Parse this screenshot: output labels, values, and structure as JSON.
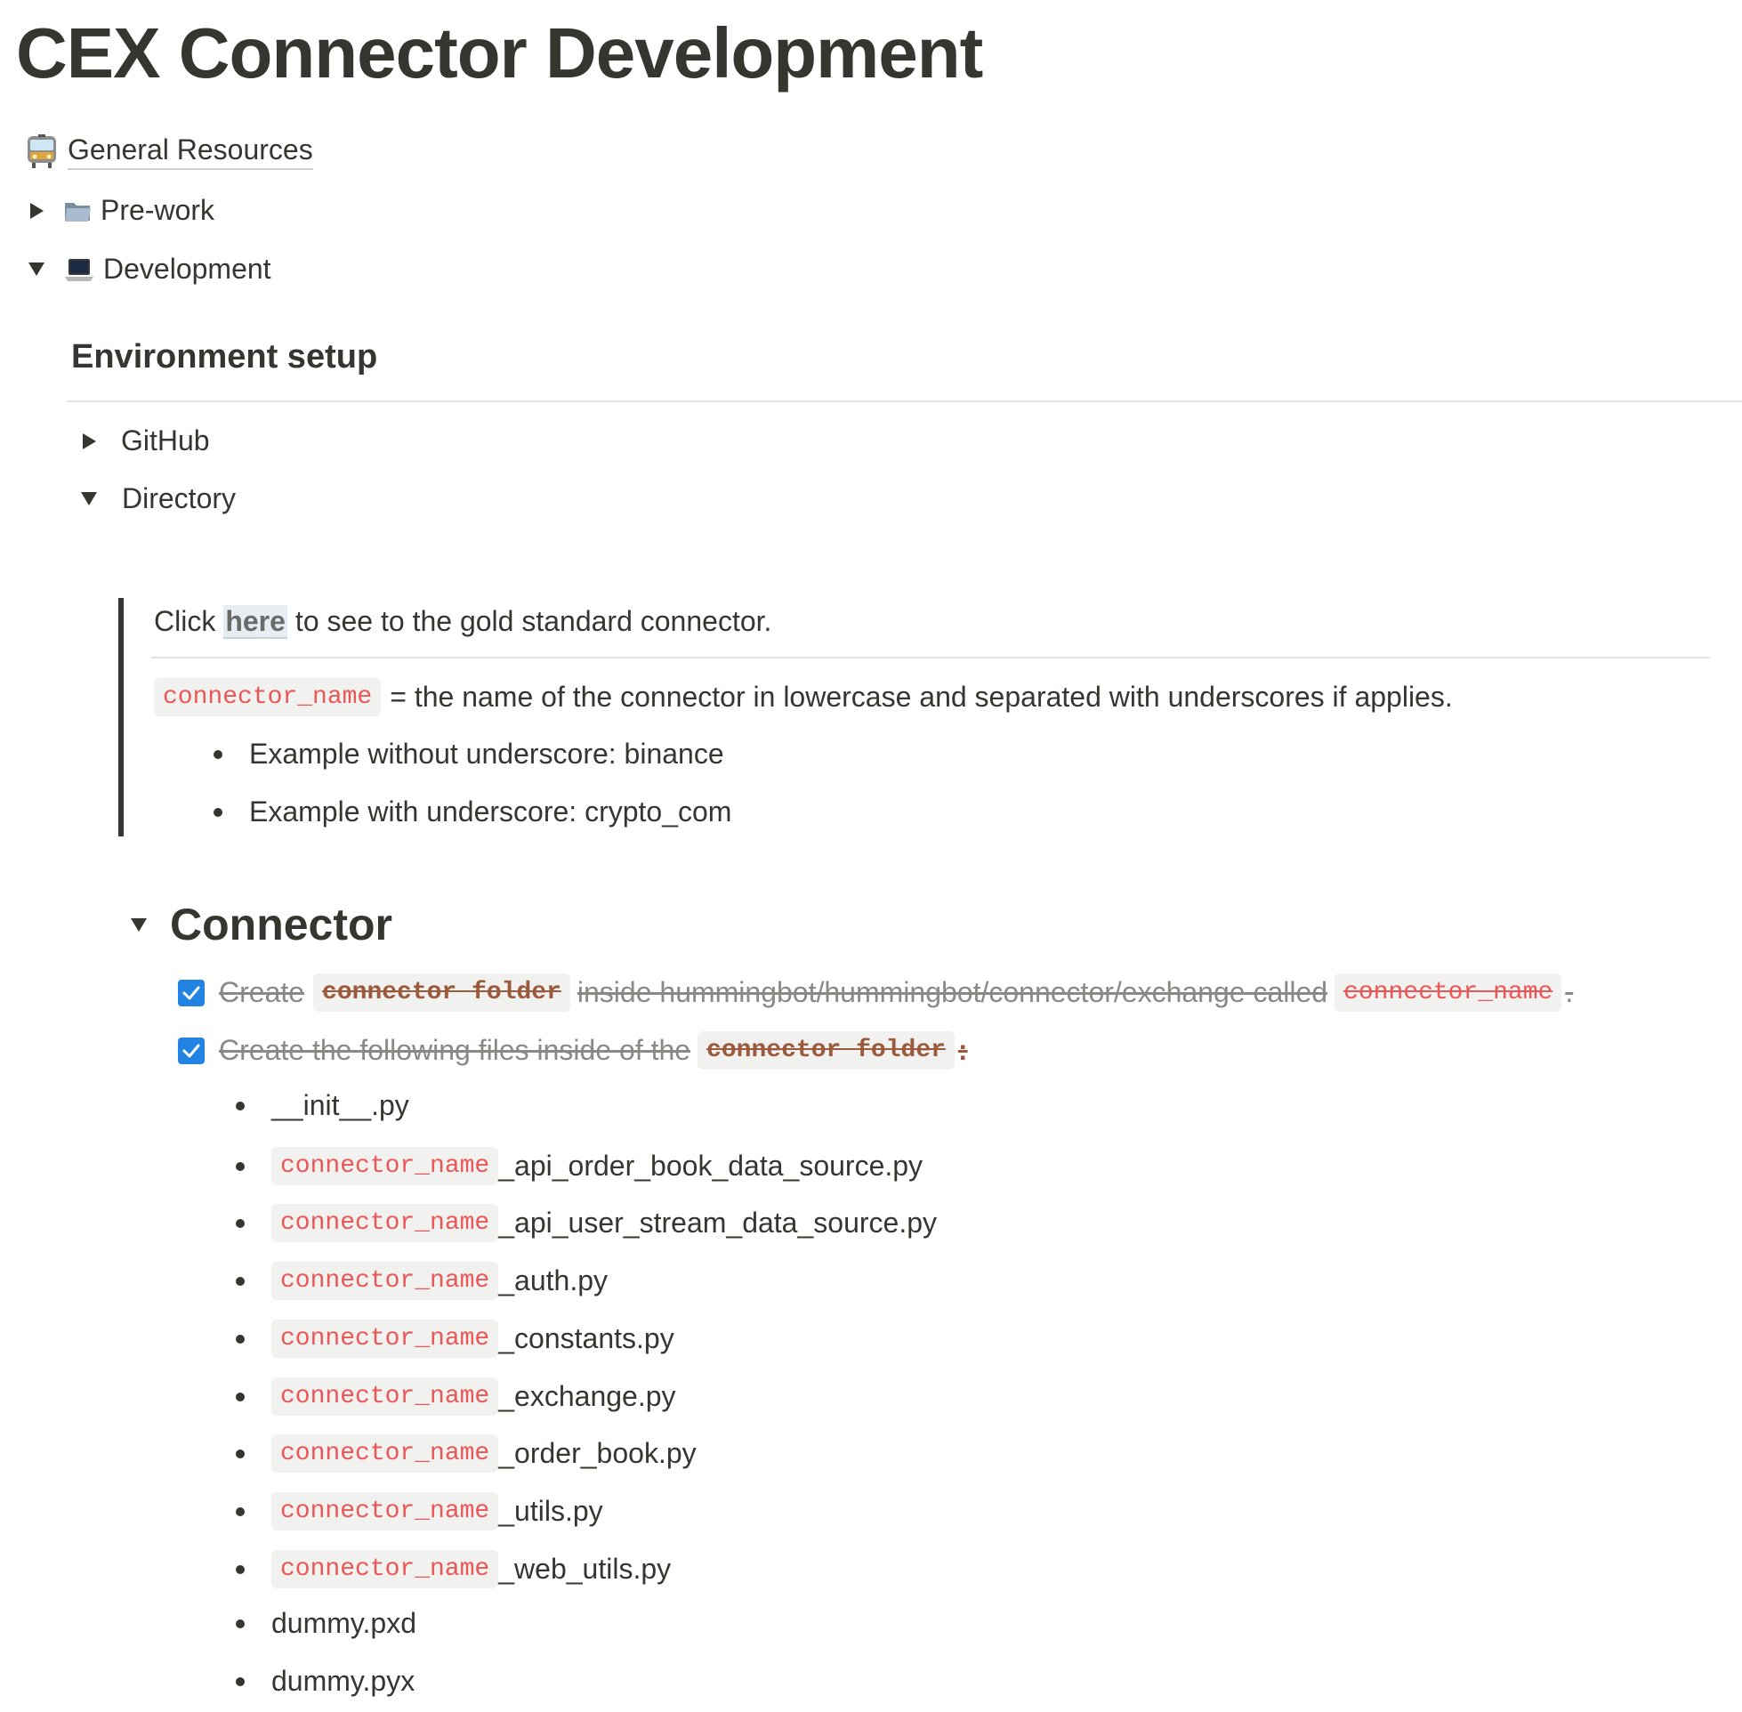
{
  "page": {
    "title": "CEX Connector Development"
  },
  "links": {
    "general_resources": "General Resources"
  },
  "toggles": {
    "prework": "Pre-work",
    "development": "Development"
  },
  "section_env": {
    "heading": "Environment setup",
    "github": "GitHub",
    "directory": "Directory"
  },
  "callout": {
    "line1_prefix": "Click",
    "line1_link": "here",
    "line1_suffix": "to see to the gold standard connector.",
    "code_term": "connector_name",
    "definition": "= the name of the connector in lowercase and separated with underscores if applies.",
    "examples": [
      "Example without underscore: binance",
      "Example with underscore: crypto_com"
    ]
  },
  "connector": {
    "heading": "Connector",
    "task1": {
      "checked": true,
      "prefix": "Create",
      "code1": "connector folder",
      "middle": "inside hummingbot/hummingbot/connector/exchange called",
      "code2": "connector_name",
      "suffix": "."
    },
    "task2": {
      "checked": true,
      "prefix": "Create the following files inside of the",
      "code": "connector folder",
      "suffix": ":"
    },
    "files": [
      {
        "code": "",
        "name": "__init__.py"
      },
      {
        "code": "connector_name",
        "name": "_api_order_book_data_source.py"
      },
      {
        "code": "connector_name",
        "name": "_api_user_stream_data_source.py"
      },
      {
        "code": "connector_name",
        "name": "_auth.py"
      },
      {
        "code": "connector_name",
        "name": "_constants.py"
      },
      {
        "code": "connector_name",
        "name": "_exchange.py"
      },
      {
        "code": "connector_name",
        "name": "_order_book.py"
      },
      {
        "code": "connector_name",
        "name": "_utils.py"
      },
      {
        "code": "connector_name",
        "name": "_web_utils.py"
      },
      {
        "code": "",
        "name": "dummy.pxd"
      },
      {
        "code": "",
        "name": "dummy.pyx"
      }
    ]
  },
  "icons": {
    "general_resources": "tram-icon",
    "prework": "folder-icon",
    "development": "laptop-icon"
  },
  "colors": {
    "text": "#37352f",
    "code_text": "#eb5757",
    "code_bg": "#f1f1ef",
    "checkbox": "#2383e2",
    "strike_text": "#8a8985"
  }
}
